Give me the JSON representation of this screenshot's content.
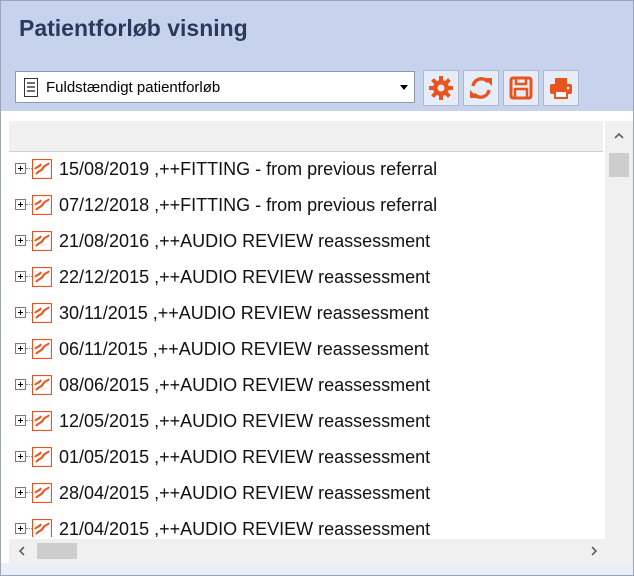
{
  "window": {
    "title": "Patientforløb visning"
  },
  "toolbar": {
    "dropdown_value": "Fuldstændigt patientforløb",
    "buttons": [
      {
        "name": "settings",
        "icon": "gear-icon"
      },
      {
        "name": "refresh",
        "icon": "refresh-icon"
      },
      {
        "name": "save",
        "icon": "save-icon"
      },
      {
        "name": "print",
        "icon": "print-icon"
      }
    ],
    "accent_color": "#e8541e"
  },
  "list": {
    "rows": [
      {
        "label": "15/08/2019 ,++FITTING - from previous referral"
      },
      {
        "label": "07/12/2018 ,++FITTING - from previous referral"
      },
      {
        "label": "21/08/2016 ,++AUDIO REVIEW reassessment"
      },
      {
        "label": "22/12/2015 ,++AUDIO REVIEW reassessment"
      },
      {
        "label": "30/11/2015 ,++AUDIO REVIEW reassessment"
      },
      {
        "label": "06/11/2015 ,++AUDIO REVIEW reassessment"
      },
      {
        "label": "08/06/2015 ,++AUDIO REVIEW reassessment"
      },
      {
        "label": "12/05/2015 ,++AUDIO REVIEW reassessment"
      },
      {
        "label": "01/05/2015 ,++AUDIO REVIEW reassessment"
      },
      {
        "label": "28/04/2015 ,++AUDIO REVIEW reassessment"
      },
      {
        "label": "21/04/2015 ,++AUDIO REVIEW reassessment"
      }
    ]
  }
}
